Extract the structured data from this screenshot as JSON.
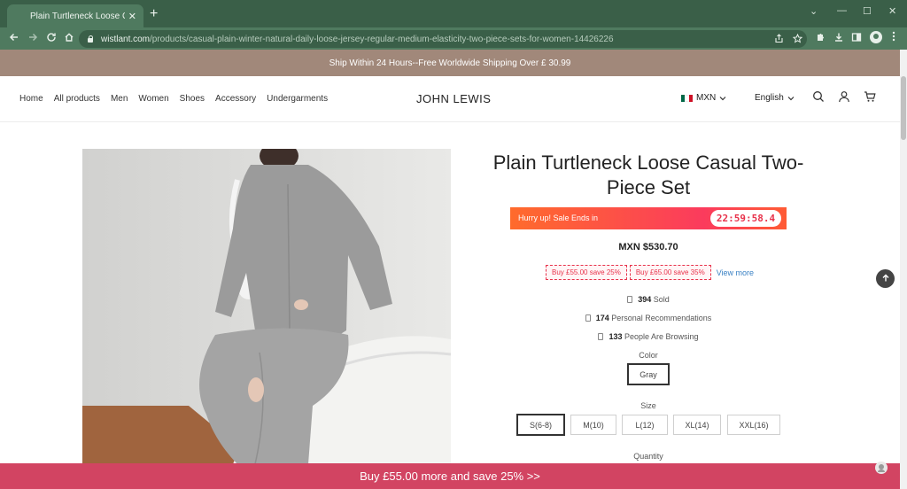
{
  "browser": {
    "tab_title": "Plain Turtleneck Loose Casual Tw",
    "tab_close": "✕",
    "new_tab": "+",
    "url_host": "wistlant.com",
    "url_path": "/products/casual-plain-winter-natural-daily-loose-jersey-regular-medium-elasticity-two-piece-sets-for-women-14426226",
    "window_controls": [
      "⌄",
      "—",
      "☐",
      "✕"
    ]
  },
  "announcement": "Ship Within 24 Hours--Free Worldwide Shipping Over £ 30.99",
  "header": {
    "nav": [
      "Home",
      "All products",
      "Men",
      "Women",
      "Shoes",
      "Accessory",
      "Undergarments"
    ],
    "brand": "JOHN LEWIS",
    "currency": "MXN",
    "language": "English",
    "flag_colors": [
      "#006847",
      "#ffffff",
      "#ce1126"
    ]
  },
  "product": {
    "title": "Plain Turtleneck Loose Casual Two-Piece Set",
    "sale_text": "Hurry up! Sale Ends in",
    "countdown": "22:59:58.4",
    "price": "MXN $530.70",
    "coupons": [
      "Buy £55.00 save 25%",
      "Buy £65.00 save 35%"
    ],
    "view_more": "View more",
    "stats": [
      {
        "value": "394",
        "label": "Sold"
      },
      {
        "value": "174",
        "label": "Personal Recommendations"
      },
      {
        "value": "133",
        "label": "People Are Browsing"
      }
    ],
    "color_label": "Color",
    "color_selected": "Gray",
    "size_label": "Size",
    "sizes": [
      "S(6-8)",
      "M(10)",
      "L(12)",
      "XL(14)",
      "XXL(16)"
    ],
    "size_selected": "S(6-8)",
    "quantity_label": "Quantity"
  },
  "promo_bar": "Buy £55.00 more and save 25%  >>",
  "colors": {
    "chrome_dark": "#3a5f48",
    "chrome_light": "#4f7a5f",
    "announce_bg": "#a1887a",
    "sale_red": "#e8324b",
    "promo_bg": "#d24462",
    "link": "#3b82c4"
  }
}
